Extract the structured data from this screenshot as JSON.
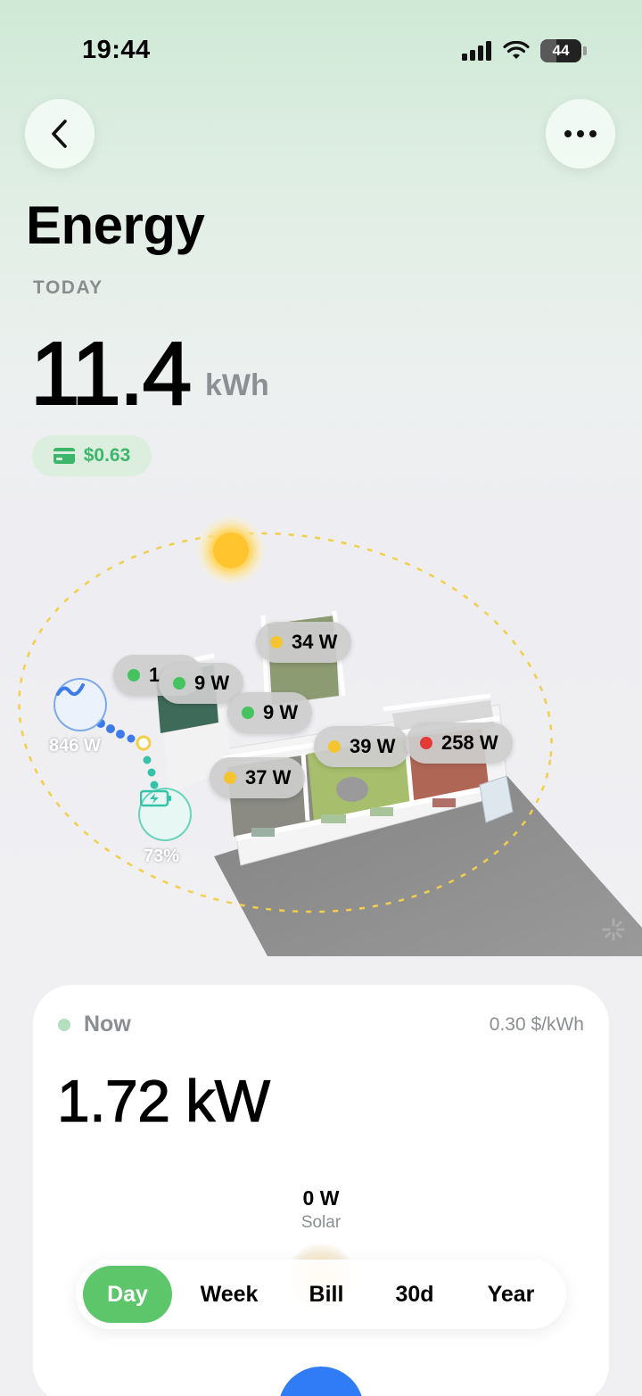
{
  "status_bar": {
    "time": "19:44",
    "battery": "44"
  },
  "nav": {
    "back_icon": "chevron-left-icon",
    "more_icon": "ellipsis-icon"
  },
  "header": {
    "title": "Energy",
    "period_label": "TODAY",
    "total_value": "11.4",
    "total_unit": "kWh",
    "cost": "$0.63"
  },
  "scene": {
    "grid_power": "846 W",
    "battery_level": "73%",
    "room_tags": [
      {
        "label": "1",
        "color": "green"
      },
      {
        "label": "9 W",
        "color": "green"
      },
      {
        "label": "34 W",
        "color": "yellow"
      },
      {
        "label": "9 W",
        "color": "green"
      },
      {
        "label": "39 W",
        "color": "yellow"
      },
      {
        "label": "258 W",
        "color": "red"
      },
      {
        "label": "37 W",
        "color": "yellow"
      }
    ]
  },
  "now_card": {
    "label": "Now",
    "rate": "0.30 $/kWh",
    "value": "1.72 kW",
    "solar_value": "0 W",
    "solar_label": "Solar"
  },
  "tabs": [
    {
      "label": "Day",
      "active": true
    },
    {
      "label": "Week",
      "active": false
    },
    {
      "label": "Bill",
      "active": false
    },
    {
      "label": "30d",
      "active": false
    },
    {
      "label": "Year",
      "active": false
    }
  ],
  "colors": {
    "accent_green": "#5dc56a",
    "status_yellow": "#f5c531",
    "status_red": "#e53935",
    "grid_blue": "#2f7cf6"
  }
}
